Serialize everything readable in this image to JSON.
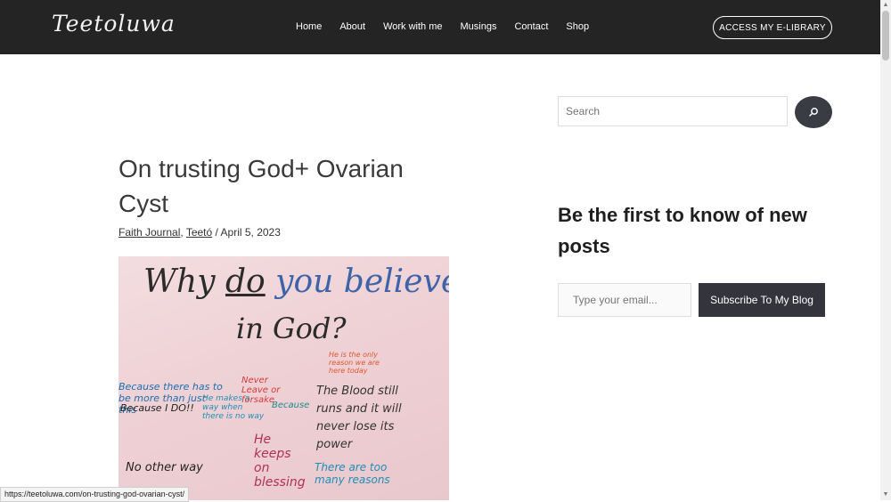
{
  "header": {
    "logo_text": "Teetoluwa",
    "nav": [
      "Home",
      "About",
      "Work with me",
      "Musings",
      "Contact",
      "Shop"
    ],
    "cta_label": "ACCESS MY E-LIBRARY"
  },
  "post": {
    "title": "On trusting God+ Ovarian Cyst",
    "categories": [
      "Faith Journal",
      "Teetó"
    ],
    "date": "April 5, 2023",
    "meta_separator": " / "
  },
  "image": {
    "headline_a": "Why",
    "headline_b": "do",
    "headline_c": "you believe",
    "headline_d": "in God?",
    "notes": [
      {
        "text": "Because there has to be more than just this",
        "color": "#1c6fb0"
      },
      {
        "text": "Because I DO!!",
        "color": "#1f1f1f"
      },
      {
        "text": "Never Leave or forsake",
        "color": "#d23a3a"
      },
      {
        "text": "He is the only reason we are here today",
        "color": "#e0562f"
      },
      {
        "text": "The Blood still runs and it will never lose its power",
        "color": "#333333"
      },
      {
        "text": "There are too many reasons",
        "color": "#1f8fb5"
      },
      {
        "text": "No other way",
        "color": "#222222"
      },
      {
        "text": "He keeps on blessing",
        "color": "#b0305a"
      },
      {
        "text": "Because",
        "color": "#1f8a8a"
      },
      {
        "text": "He makes a way when there is no way",
        "color": "#1f8fb5"
      }
    ]
  },
  "status_url": "https://teetoluwa.com/on-trusting-god-ovarian-cyst/",
  "sidebar": {
    "search_placeholder": "Search",
    "widget_title": "Be the first to know of new posts",
    "email_placeholder": "Type your email...",
    "subscribe_label": "Subscribe To My Blog"
  },
  "colors": {
    "header_bg": "#242424",
    "button_dark": "#33343c",
    "image_pink": "#efd2d6"
  },
  "icons": {
    "search": "search-icon"
  }
}
